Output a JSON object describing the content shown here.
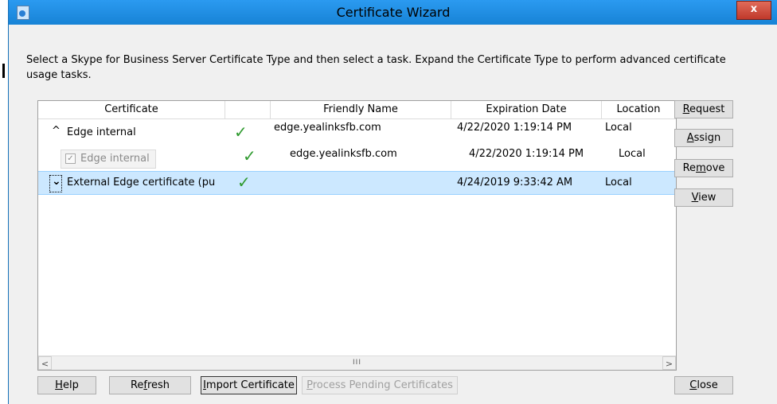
{
  "window": {
    "title": "Certificate Wizard",
    "close_glyph": "x"
  },
  "description": "Select a Skype for Business Server Certificate Type and then select a task. Expand the Certificate Type to perform advanced certificate usage tasks.",
  "columns": [
    "Certificate",
    "",
    "Friendly Name",
    "Expiration Date",
    "Location"
  ],
  "rows": [
    {
      "certificate": "Edge internal",
      "friendly_name": "edge.yealinksfb.com",
      "expiration": "4/22/2020 1:19:14 PM",
      "location": "Local"
    },
    {
      "certificate": "Edge internal",
      "friendly_name": "edge.yealinksfb.com",
      "expiration": "4/22/2020 1:19:14 PM",
      "location": "Local"
    },
    {
      "certificate": "External Edge certificate (pu",
      "friendly_name": "",
      "expiration": "4/24/2019 9:33:42 AM",
      "location": "Local"
    }
  ],
  "side_buttons": {
    "request": {
      "mnemonic": "R",
      "rest": "equest"
    },
    "assign": {
      "mnemonic": "A",
      "rest": "ssign"
    },
    "remove": {
      "pre": "Re",
      "mnemonic": "m",
      "rest": "ove"
    },
    "view": {
      "mnemonic": "V",
      "rest": "iew"
    }
  },
  "bottom_buttons": {
    "help": {
      "mnemonic": "H",
      "rest": "elp"
    },
    "refresh": {
      "pre": "Re",
      "mnemonic": "f",
      "rest": "resh"
    },
    "import": {
      "mnemonic": "I",
      "rest": "mport Certificate"
    },
    "pending": {
      "mnemonic": "P",
      "rest": "rocess Pending Certificates"
    },
    "close": {
      "mnemonic": "C",
      "rest": "lose"
    }
  },
  "scrollbar": {
    "left_arrow": "<",
    "right_arrow": ">",
    "grip": "III"
  },
  "glyphs": {
    "check": "✓",
    "expanded": "^",
    "collapsed": "⌄",
    "checkbox": "☑"
  },
  "colors": {
    "title_bar": "#1e8fe0",
    "selection": "#cce8ff",
    "check": "#2f9a2f"
  }
}
